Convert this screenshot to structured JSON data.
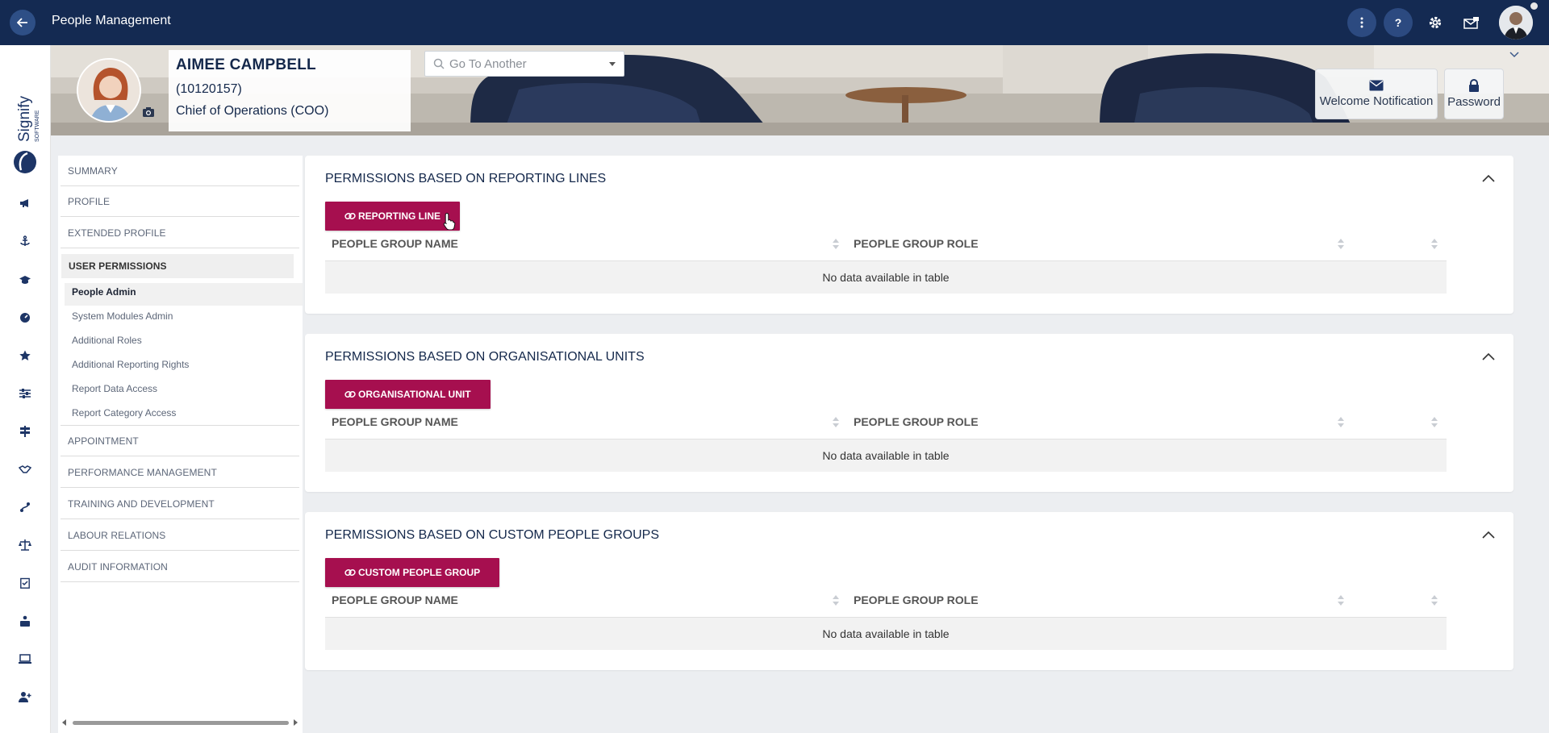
{
  "topbar": {
    "title": "People Management",
    "icons": [
      "arrow-left-icon",
      "more-vertical-icon",
      "help-icon",
      "gear-icon",
      "messages-icon",
      "user-avatar"
    ],
    "colors": {
      "bar": "#142a52",
      "round_button": "#2c4a80"
    }
  },
  "rail": {
    "logo_text": "Signify",
    "logo_subtext": "SOFTWARE",
    "icons": [
      "megaphone-icon",
      "anchor-icon",
      "graduation-cap-icon",
      "dashboard-icon",
      "star-icon",
      "sliders-icon",
      "signpost-icon",
      "handshake-icon",
      "routes-icon",
      "scales-icon",
      "checklist-icon",
      "briefcase-user-icon",
      "laptop-icon",
      "user-plus-icon"
    ]
  },
  "profile": {
    "name": "AIMEE CAMPBELL",
    "employee_number": "(10120157)",
    "job_title": "Chief of Operations (COO)",
    "goto_placeholder": "Go To Another",
    "actions": {
      "welcome_notification": "Welcome Notification",
      "password": "Password"
    }
  },
  "nav": {
    "items_top": [
      "SUMMARY",
      "PROFILE",
      "EXTENDED PROFILE"
    ],
    "active": "USER PERMISSIONS",
    "sub_items": [
      "People Admin",
      "System Modules Admin",
      "Additional Roles",
      "Additional Reporting Rights",
      "Report Data Access",
      "Report Category Access"
    ],
    "selected_sub": "People Admin",
    "items_bottom": [
      "APPOINTMENT",
      "PERFORMANCE MANAGEMENT",
      "TRAINING AND DEVELOPMENT",
      "LABOUR RELATIONS",
      "AUDIT INFORMATION"
    ]
  },
  "cards": [
    {
      "title": "PERMISSIONS BASED ON REPORTING LINES",
      "button": "REPORTING LINE",
      "col1": "PEOPLE GROUP NAME",
      "col2": "PEOPLE GROUP ROLE",
      "empty": "No data available in table"
    },
    {
      "title": "PERMISSIONS BASED ON ORGANISATIONAL UNITS",
      "button": "ORGANISATIONAL UNIT",
      "col1": "PEOPLE GROUP NAME",
      "col2": "PEOPLE GROUP ROLE",
      "empty": "No data available in table"
    },
    {
      "title": "PERMISSIONS BASED ON CUSTOM PEOPLE GROUPS",
      "button": "CUSTOM PEOPLE GROUP",
      "col1": "PEOPLE GROUP NAME",
      "col2": "PEOPLE GROUP ROLE",
      "empty": "No data available in table"
    }
  ],
  "colors": {
    "accent_button": "#a60f4f",
    "heading": "#14284b",
    "background": "#eceef1"
  }
}
